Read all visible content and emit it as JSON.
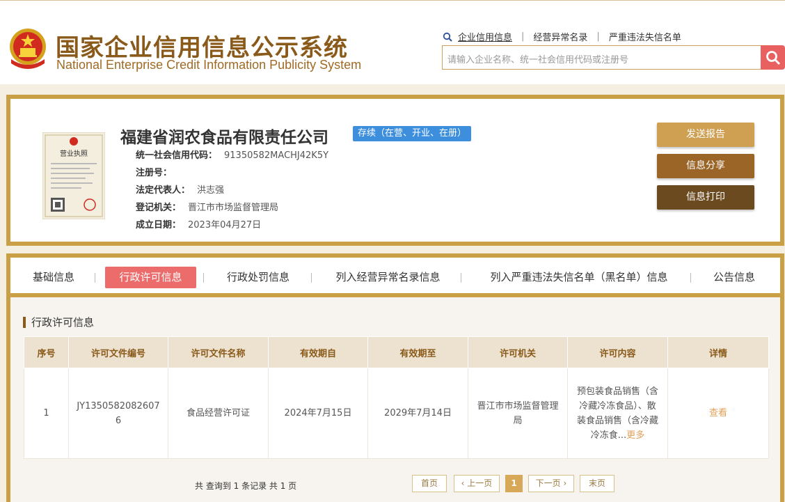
{
  "header": {
    "title_cn": "国家企业信用信息公示系统",
    "title_en": "National Enterprise Credit Information Publicity System",
    "links": [
      "企业信用信息",
      "经营异常名录",
      "严重违法失信名单"
    ],
    "search_placeholder": "请输入企业名称、统一社会信用代码或注册号"
  },
  "company": {
    "name": "福建省润农食品有限责任公司",
    "status": "存续（在营、开业、在册）",
    "fields": [
      {
        "label": "统一社会信用代码：",
        "value": "91350582MACHJ42K5Y"
      },
      {
        "label": "注册号：",
        "value": ""
      },
      {
        "label": "法定代表人：",
        "value": "洪志强"
      },
      {
        "label": "登记机关：",
        "value": "晋江市市场监督管理局"
      },
      {
        "label": "成立日期：",
        "value": "2023年04月27日"
      }
    ],
    "license_label": "营业执照",
    "buttons": [
      "发送报告",
      "信息分享",
      "信息打印"
    ]
  },
  "tabs": [
    "基础信息",
    "行政许可信息",
    "行政处罚信息",
    "列入经营异常名录信息",
    "列入严重违法失信名单（黑名单）信息",
    "公告信息"
  ],
  "section": {
    "title": "行政许可信息",
    "columns": [
      "序号",
      "许可文件编号",
      "许可文件名称",
      "有效期自",
      "有效期至",
      "许可机关",
      "许可内容",
      "详情"
    ],
    "rows": [
      {
        "no": "1",
        "doc_no": "JY13505820826076",
        "doc_name": "食品经营许可证",
        "from": "2024年7月15日",
        "to": "2029年7月14日",
        "authority": "晋江市市场监督管理局",
        "content": "预包装食品销售（含冷藏冷冻食品）、散装食品销售（含冷藏冷冻食...",
        "more": "更多",
        "detail": "查看"
      }
    ]
  },
  "pager": {
    "summary": "共 查询到 1 条记录 共 1 页",
    "first": "首页",
    "prev": "上一页",
    "current": "1",
    "next": "下一页",
    "last": "末页"
  },
  "colors": {
    "gold": "#c9a046",
    "brown": "#8a5a1a",
    "accent_red": "#ec6b6b",
    "status_blue": "#3d8fde"
  }
}
